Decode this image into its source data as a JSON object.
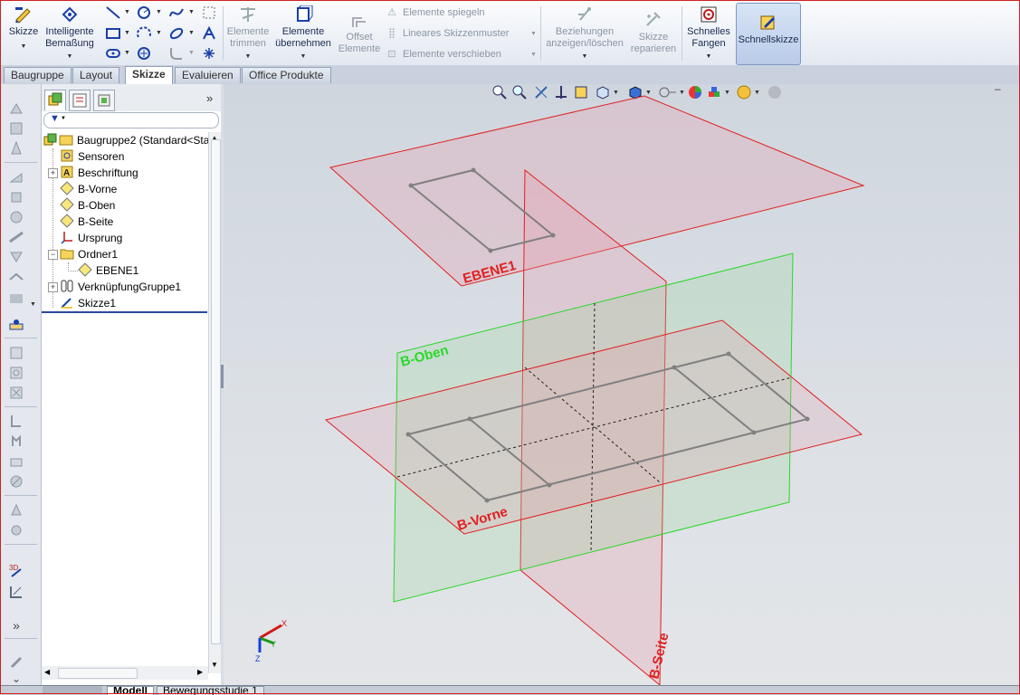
{
  "ribbon": {
    "skizze": "Skizze",
    "intelligente": "Intelligente",
    "bemassung": "Bemaßung",
    "elemente_trimmen_1": "Elemente",
    "elemente_trimmen_2": "trimmen",
    "elemente_uebernehmen_1": "Elemente",
    "elemente_uebernehmen_2": "übernehmen",
    "offset_1": "Offset",
    "offset_2": "Elemente",
    "elemente_spiegeln": "Elemente spiegeln",
    "lineares_muster": "Lineares Skizzenmuster",
    "elemente_verschieben": "Elemente verschieben",
    "beziehungen_1": "Beziehungen",
    "beziehungen_2": "anzeigen/löschen",
    "reparieren_1": "Skizze",
    "reparieren_2": "reparieren",
    "fangen_1": "Schnelles",
    "fangen_2": "Fangen",
    "schnellskizze": "Schnellskizze"
  },
  "tabs": [
    "Baugruppe",
    "Layout",
    "Skizze",
    "Evaluieren",
    "Office Produkte"
  ],
  "active_tab": "Skizze",
  "feature_tree": {
    "root": "Baugruppe2  (Standard<Sta",
    "items": [
      "Sensoren",
      "Beschriftung",
      "B-Vorne",
      "B-Oben",
      "B-Seite",
      "Ursprung",
      "Ordner1",
      "EBENE1",
      "VerknüpfungGruppe1",
      "Skizze1"
    ],
    "expand_chevron": "»"
  },
  "viewport": {
    "plane_labels": {
      "ebene1": "EBENE1",
      "b_oben": "B-Oben",
      "b_vorne": "B-Vorne",
      "b_seite": "B-Seite"
    },
    "triad": {
      "x": "X",
      "y": "Y",
      "z": "Z"
    },
    "colors": {
      "red_plane": "#e02020",
      "green_plane": "#2ad82a",
      "sketch": "#808080"
    }
  },
  "bottom_tabs": [
    "Modell",
    "Bewegungsstudie 1"
  ],
  "active_bottom_tab": "Modell"
}
